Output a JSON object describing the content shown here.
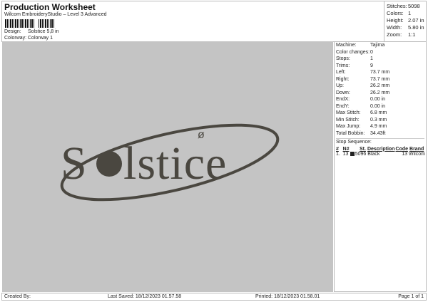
{
  "header": {
    "title": "Production Worksheet",
    "subtitle": "Wilcom EmbroideryStudio – Level 3 Advanced",
    "design_label": "Design:",
    "design_value": "Solstice 5,8 in",
    "colorway_label": "Colorway:",
    "colorway_value": "Colorway 1"
  },
  "stats": [
    {
      "k": "Stitches:",
      "v": "5098"
    },
    {
      "k": "Colors:",
      "v": "1"
    },
    {
      "k": "Height:",
      "v": "2.07 in"
    },
    {
      "k": "Width:",
      "v": "5.80 in"
    },
    {
      "k": "Zoom:",
      "v": "1:1"
    }
  ],
  "design": {
    "logo_text": "Solstice",
    "thread_color": "#4a4740",
    "background": "#c4c4c4"
  },
  "info": [
    {
      "k": "Machine:",
      "v": "Tajima"
    },
    {
      "k": "Color changes:",
      "v": "0"
    },
    {
      "k": "Stops:",
      "v": "1"
    },
    {
      "k": "Trims:",
      "v": "9"
    },
    {
      "k": "Left:",
      "v": "73.7 mm"
    },
    {
      "k": "Right:",
      "v": "73.7 mm"
    },
    {
      "k": "Up:",
      "v": "26.2 mm"
    },
    {
      "k": "Down:",
      "v": "26.2 mm"
    },
    {
      "k": "EndX:",
      "v": "0.00 in"
    },
    {
      "k": "EndY:",
      "v": "0.00 in"
    },
    {
      "k": "Max Stitch:",
      "v": "6.8 mm"
    },
    {
      "k": "Min Stitch:",
      "v": "0.3 mm"
    },
    {
      "k": "Max Jump:",
      "v": "4.9 mm"
    },
    {
      "k": "Total Bobbin:",
      "v": "34.43ft"
    }
  ],
  "stop_sequence": {
    "title": "Stop Sequence:",
    "headers": [
      "#",
      "N#",
      "St.",
      "Description",
      "Code",
      "Brand"
    ],
    "rows": [
      {
        "num": "1.",
        "n": "13",
        "st": "5096",
        "desc": "Black",
        "code": "13",
        "brand": "Wilcom",
        "color": "#222222"
      }
    ]
  },
  "footer": {
    "created": "Created By:",
    "saved": "Last Saved: 18/12/2023 01.57.58",
    "printed": "Printed: 18/12/2023 01.58.01",
    "page": "Page 1 of 1"
  }
}
